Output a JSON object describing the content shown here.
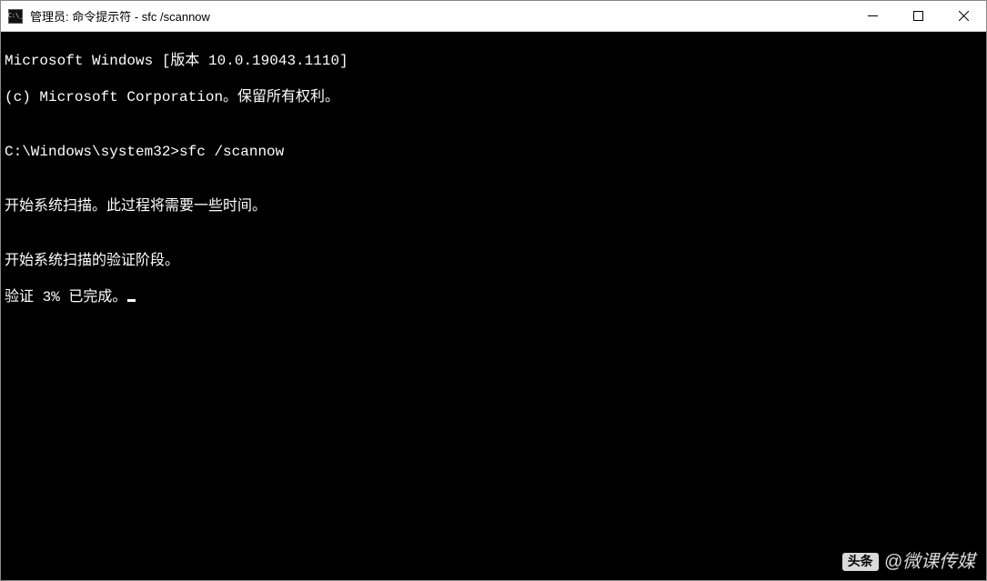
{
  "titlebar": {
    "text": "管理员: 命令提示符 - sfc  /scannow"
  },
  "terminal": {
    "line1": "Microsoft Windows [版本 10.0.19043.1110]",
    "line2": "(c) Microsoft Corporation。保留所有权利。",
    "blank1": "",
    "prompt_line": "C:\\Windows\\system32>sfc /scannow",
    "blank2": "",
    "scan_start": "开始系统扫描。此过程将需要一些时间。",
    "blank3": "",
    "verify_start": "开始系统扫描的验证阶段。",
    "verify_progress": "验证 3% 已完成。"
  },
  "watermark": {
    "badge": "头条",
    "text": "@微课传媒"
  }
}
